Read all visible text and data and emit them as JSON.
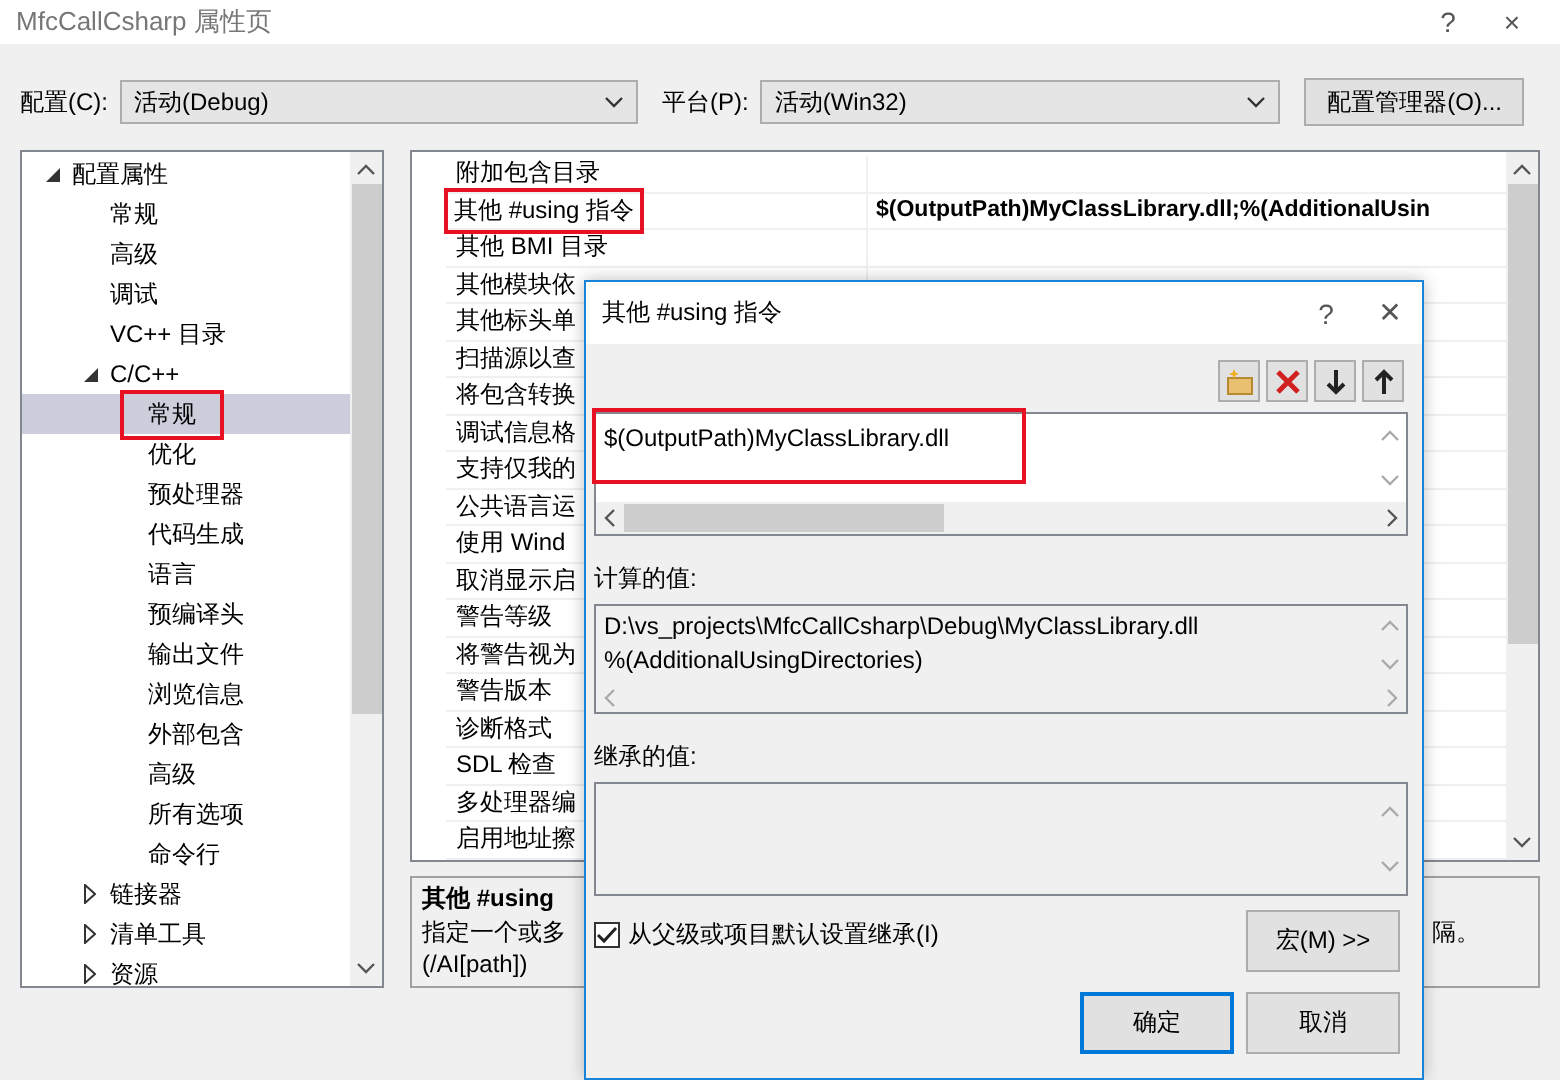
{
  "window": {
    "title": "MfcCallCsharp 属性页",
    "help": "?",
    "close": "×"
  },
  "config_bar": {
    "config_label": "配置(C):",
    "config_value": "活动(Debug)",
    "platform_label": "平台(P):",
    "platform_value": "活动(Win32)",
    "manager_button": "配置管理器(O)..."
  },
  "tree": [
    {
      "label": "配置属性",
      "expanded": true,
      "selected": false,
      "children": [
        {
          "label": "常规",
          "selected": false
        },
        {
          "label": "高级",
          "selected": false
        },
        {
          "label": "调试",
          "selected": false
        },
        {
          "label": "VC++ 目录",
          "selected": false
        },
        {
          "label": "C/C++",
          "expanded": true,
          "selected": false,
          "children": [
            {
              "label": "常规",
              "selected": true,
              "highlighted": true
            },
            {
              "label": "优化",
              "selected": false
            },
            {
              "label": "预处理器",
              "selected": false
            },
            {
              "label": "代码生成",
              "selected": false
            },
            {
              "label": "语言",
              "selected": false
            },
            {
              "label": "预编译头",
              "selected": false
            },
            {
              "label": "输出文件",
              "selected": false
            },
            {
              "label": "浏览信息",
              "selected": false
            },
            {
              "label": "外部包含",
              "selected": false
            },
            {
              "label": "高级",
              "selected": false
            },
            {
              "label": "所有选项",
              "selected": false
            },
            {
              "label": "命令行",
              "selected": false
            }
          ]
        },
        {
          "label": "链接器",
          "expanded": false,
          "selected": false
        },
        {
          "label": "清单工具",
          "expanded": false,
          "selected": false
        },
        {
          "label": "资源",
          "expanded": false,
          "selected": false
        }
      ]
    }
  ],
  "properties": [
    {
      "name": "附加包含目录",
      "highlighted": false
    },
    {
      "name": "其他 #using 指令",
      "value": "$(OutputPath)MyClassLibrary.dll;%(AdditionalUsin",
      "highlighted": true
    },
    {
      "name": "其他 BMI 目录",
      "highlighted": false
    },
    {
      "name": "其他模块依",
      "highlighted": false
    },
    {
      "name": "其他标头单",
      "highlighted": false
    },
    {
      "name": "扫描源以查",
      "highlighted": false
    },
    {
      "name": "将包含转换",
      "highlighted": false
    },
    {
      "name": "调试信息格",
      "highlighted": false
    },
    {
      "name": "支持仅我的",
      "highlighted": false
    },
    {
      "name": "公共语言运",
      "highlighted": false
    },
    {
      "name": "使用 Wind",
      "highlighted": false
    },
    {
      "name": "取消显示启",
      "highlighted": false
    },
    {
      "name": "警告等级",
      "highlighted": false
    },
    {
      "name": "将警告视为",
      "highlighted": false
    },
    {
      "name": "警告版本",
      "highlighted": false
    },
    {
      "name": "诊断格式",
      "highlighted": false
    },
    {
      "name": "SDL 检查",
      "highlighted": false
    },
    {
      "name": "多处理器编",
      "highlighted": false
    },
    {
      "name": "启用地址擦",
      "highlighted": false
    }
  ],
  "description": {
    "title": "其他 #using",
    "text_left": "指定一个或多",
    "text_right": "隔。",
    "switch": "(/AI[path])"
  },
  "dialog": {
    "title": "其他 #using 指令",
    "help": "?",
    "close": "✕",
    "entries": [
      {
        "text": "$(OutputPath)MyClassLibrary.dll",
        "highlighted": true
      }
    ],
    "computed_label": "计算的值:",
    "computed_lines": [
      "D:\\vs_projects\\MfcCallCsharp\\Debug\\MyClassLibrary.dll",
      "%(AdditionalUsingDirectories)"
    ],
    "inherited_label": "继承的值:",
    "inherit_checkbox": {
      "label": "从父级或项目默认设置继承(I)",
      "checked": true
    },
    "macro_button": "宏(M) >>",
    "ok_button": "确定",
    "cancel_button": "取消"
  }
}
